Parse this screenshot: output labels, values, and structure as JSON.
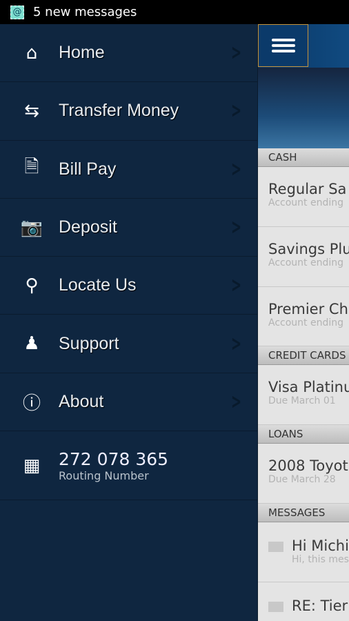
{
  "status_bar": {
    "icon": "email-at-icon",
    "text": "5 new messages"
  },
  "sidebar": {
    "items": [
      {
        "label": "Home",
        "icon": "home-icon"
      },
      {
        "label": "Transfer Money",
        "icon": "transfer-arrows-icon"
      },
      {
        "label": "Bill Pay",
        "icon": "document-icon"
      },
      {
        "label": "Deposit",
        "icon": "camera-icon"
      },
      {
        "label": "Locate Us",
        "icon": "map-pin-icon"
      },
      {
        "label": "Support",
        "icon": "users-icon"
      },
      {
        "label": "About",
        "icon": "info-icon"
      }
    ],
    "routing": {
      "number": "272 078 365",
      "label": "Routing Number"
    }
  },
  "main": {
    "sections": {
      "cash": "CASH",
      "credit": "CREDIT CARDS",
      "loans": "LOANS",
      "messages": "MESSAGES"
    },
    "cash": [
      {
        "title": "Regular Sa",
        "sub": "Account ending"
      },
      {
        "title": "Savings Plu",
        "sub": "Account ending"
      },
      {
        "title": "Premier Ch",
        "sub": "Account ending"
      }
    ],
    "credit": [
      {
        "title": "Visa Platinu",
        "sub": "Due March 01"
      }
    ],
    "loans": [
      {
        "title": "2008 Toyot",
        "sub": "Due March 28"
      }
    ],
    "messages": [
      {
        "title": "Hi Michi",
        "sub": "Hi, this mes"
      },
      {
        "title": "RE: Tier",
        "sub": ""
      }
    ]
  },
  "colors": {
    "sidebar": "#0f2640",
    "header": "#0b3866",
    "menu_border": "#c8943a"
  }
}
